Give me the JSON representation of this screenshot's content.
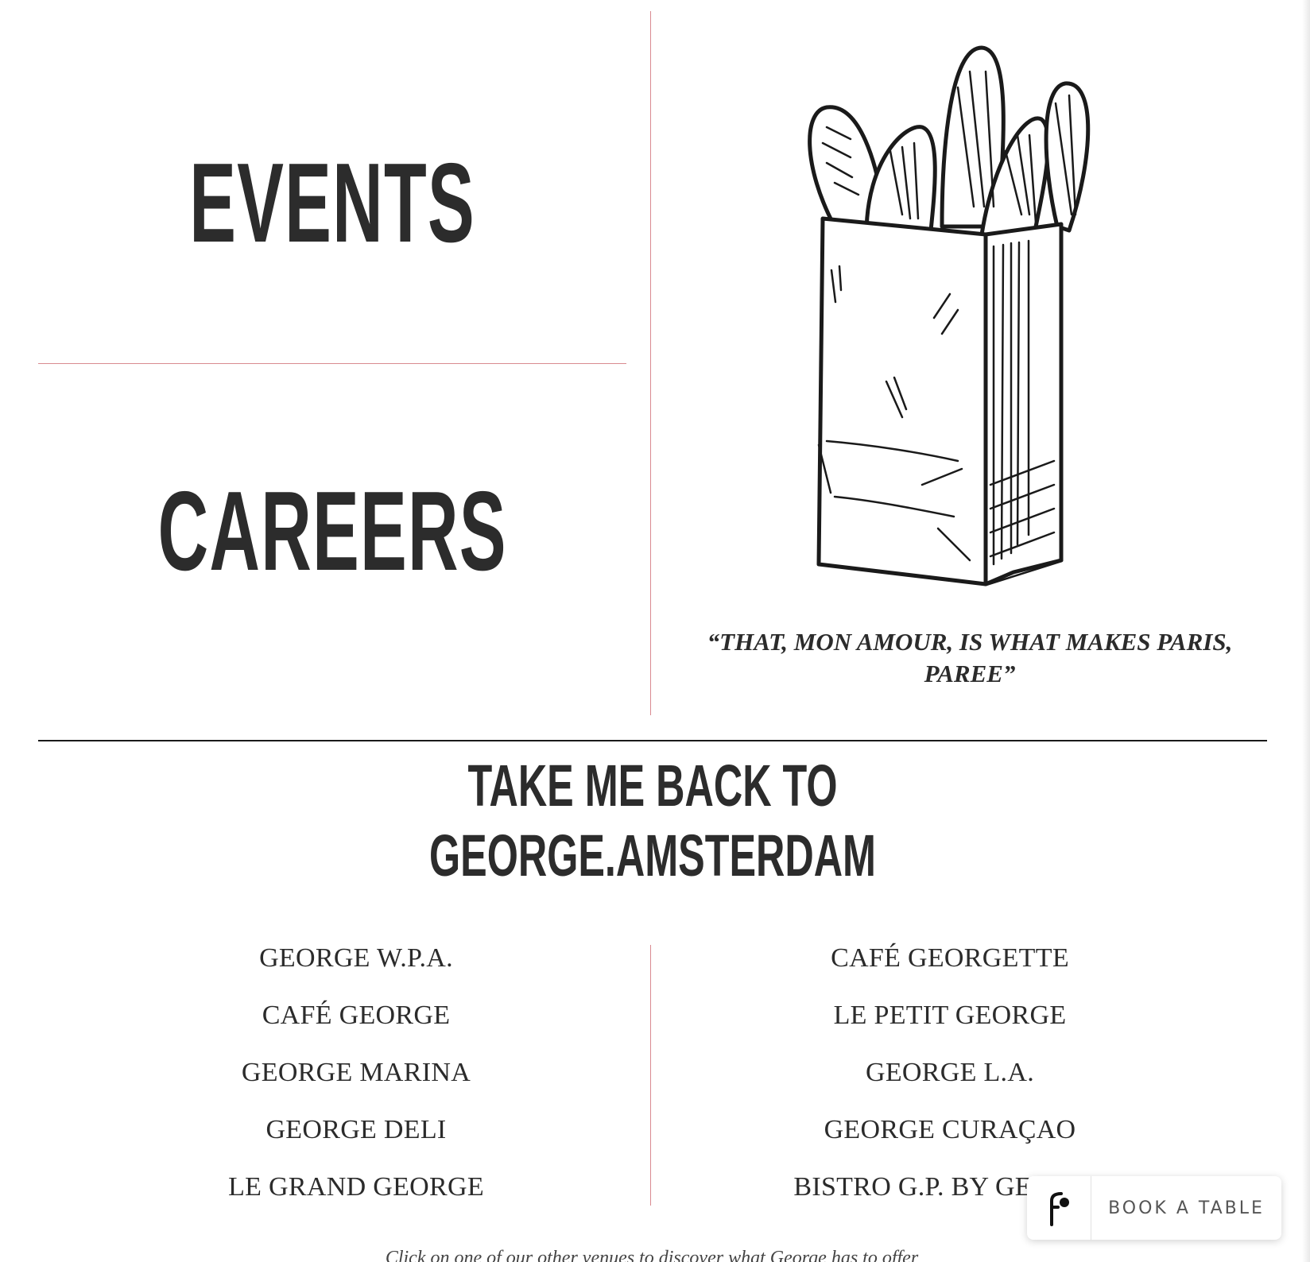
{
  "nav_links": {
    "events_label": "EVENTS",
    "careers_label": "CAREERS"
  },
  "illustration": {
    "icon": "baguette-bag-illustration"
  },
  "quote": {
    "text": "“THAT, MON AMOUR, IS WHAT MAKES PARIS, PAREE”"
  },
  "take_me_back": {
    "line1": "TAKE ME BACK TO",
    "line2": "GEORGE.AMSTERDAM"
  },
  "venues": {
    "left": [
      "GEORGE W.P.A.",
      "CAFÉ GEORGE",
      "GEORGE MARINA",
      "GEORGE DELI",
      "LE GRAND GEORGE"
    ],
    "right": [
      "CAFÉ GEORGETTE",
      "LE PETIT GEORGE",
      "GEORGE L.A.",
      "GEORGE CURAÇAO",
      "BISTRO G.P. BY GEORGE"
    ]
  },
  "footer": {
    "note": "Click on one of our other venues to discover what George has to offer"
  },
  "book_widget": {
    "label": "BOOK A TABLE",
    "icon": "reservation-logo-icon"
  },
  "colors": {
    "divider_pink": "#d98a90",
    "divider_dark": "#1a1a1a",
    "text_dark": "#2c2c2c"
  }
}
